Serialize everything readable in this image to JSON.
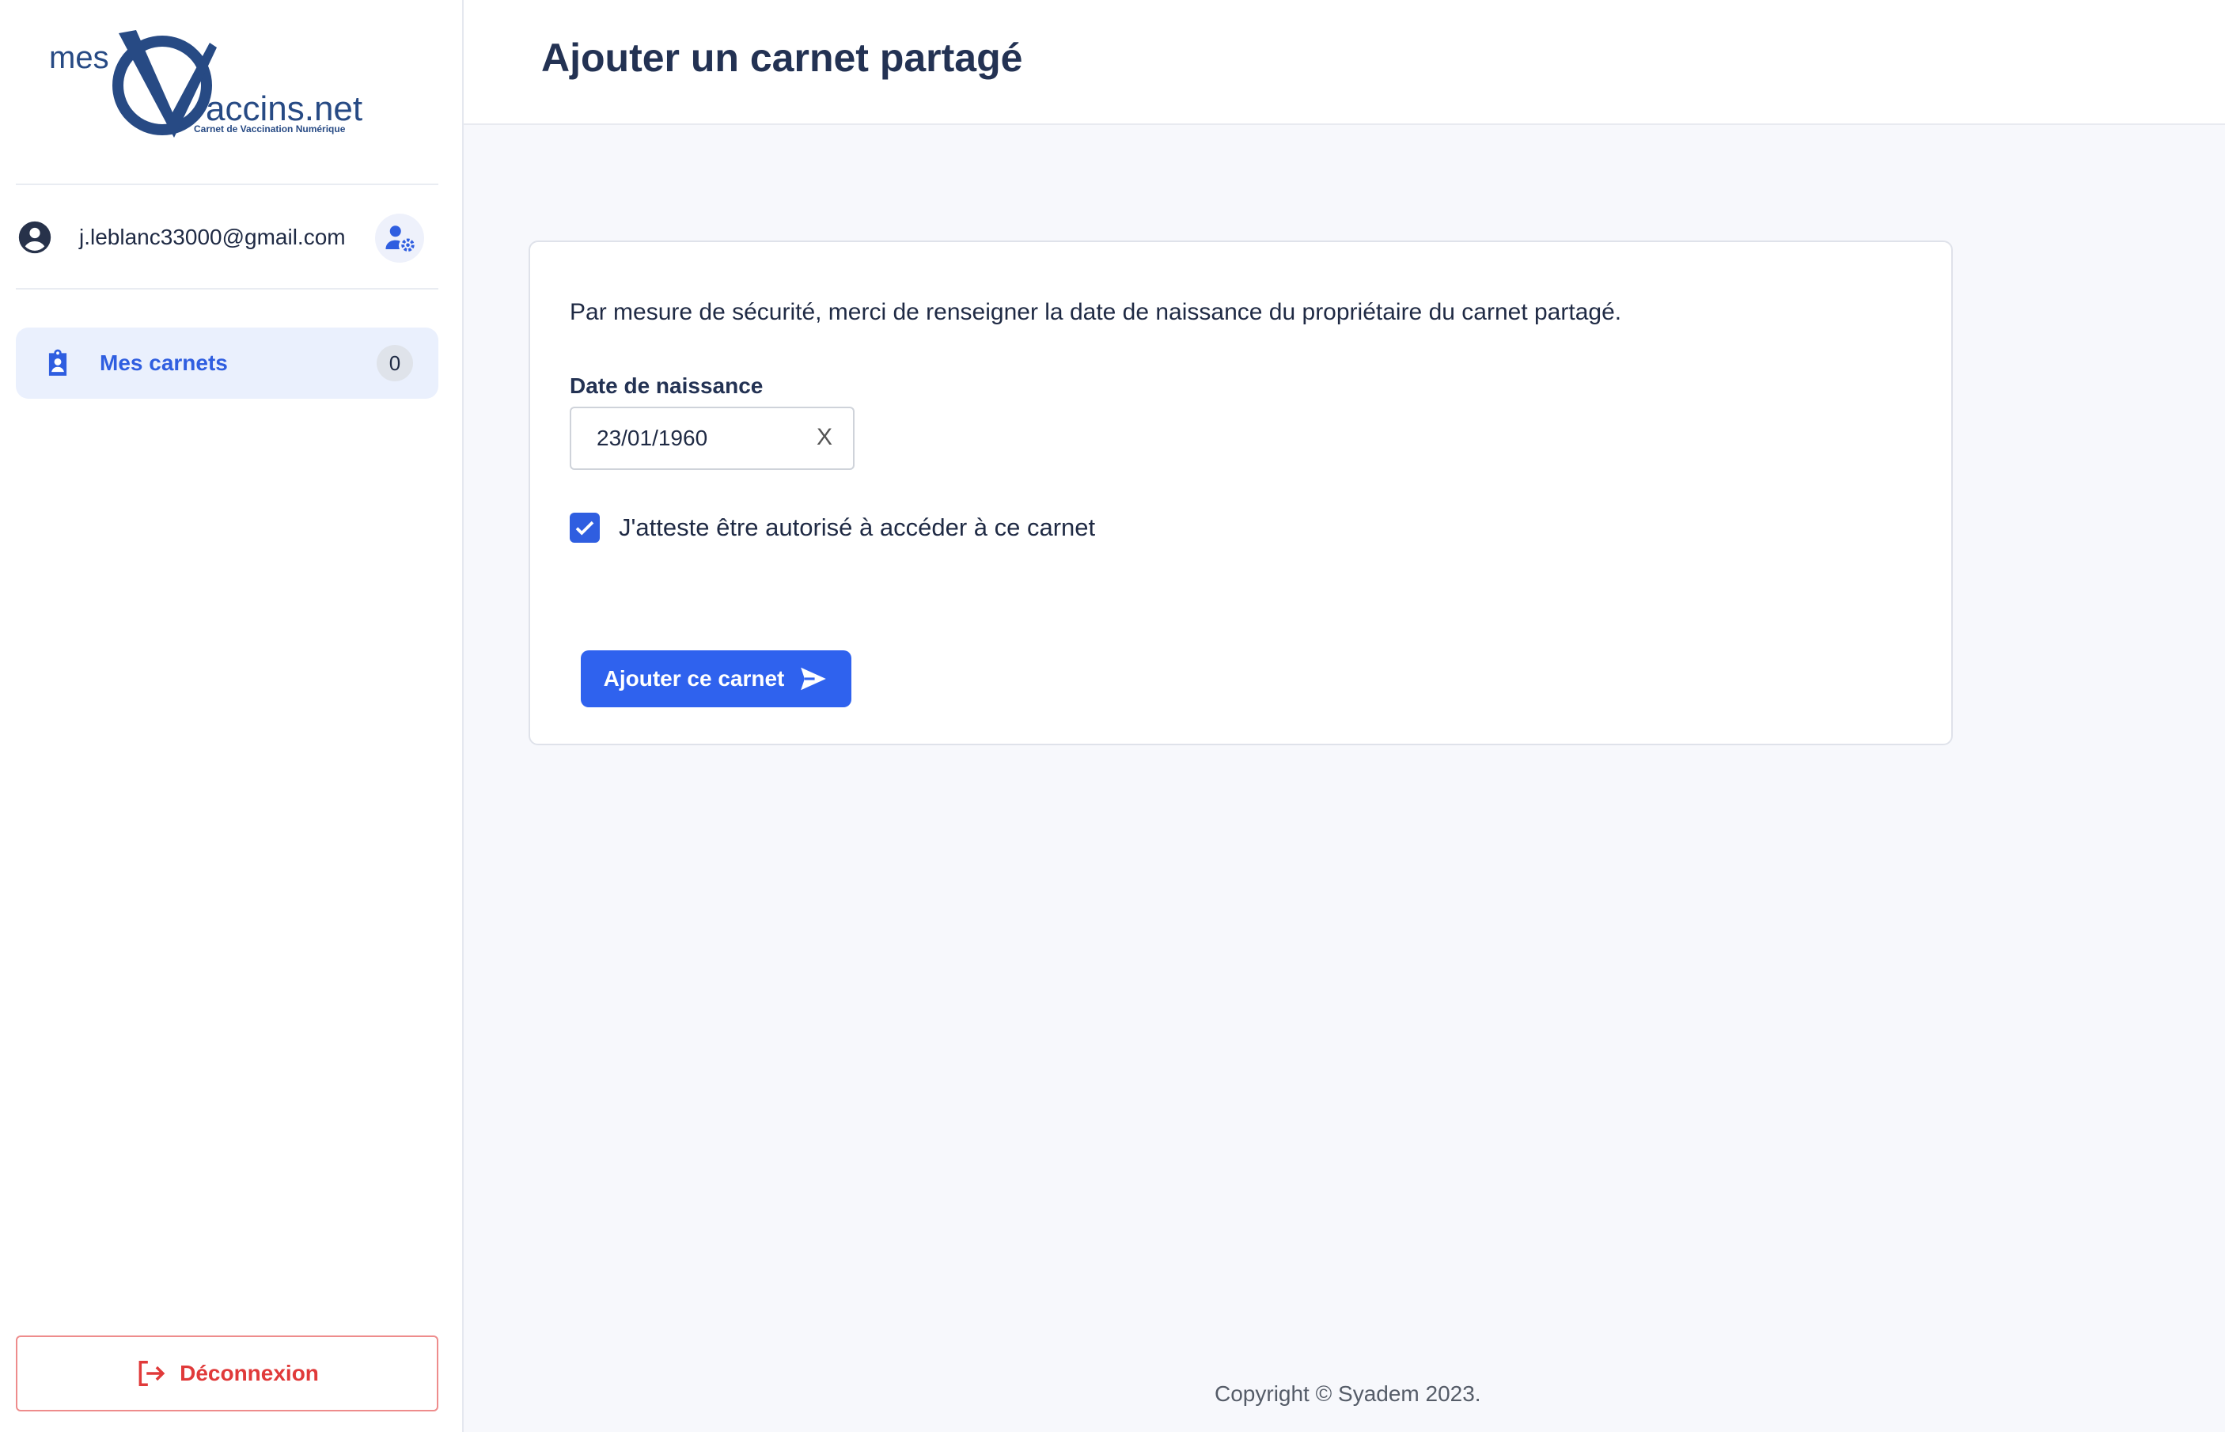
{
  "sidebar": {
    "logo": {
      "text_mes": "mes",
      "text_brand": "accins.net",
      "subtitle": "Carnet de Vaccination Numérique"
    },
    "user": {
      "email": "j.leblanc33000@gmail.com",
      "icon": "account-circle-icon",
      "settings_icon": "user-settings-icon"
    },
    "nav": [
      {
        "label": "Mes carnets",
        "badge": "0",
        "icon": "clipboard-account-icon"
      }
    ],
    "logout": {
      "label": "Déconnexion",
      "icon": "logout-icon"
    }
  },
  "header": {
    "title": "Ajouter un carnet partagé"
  },
  "form": {
    "intro": "Par mesure de sécurité, merci de renseigner la date de naissance du propriétaire du carnet partagé.",
    "birthdate_label": "Date de naissance",
    "birthdate_value": "23/01/1960",
    "clear_label": "X",
    "consent_label": "J'atteste être autorisé à accéder à ce carnet",
    "consent_checked": true,
    "submit_label": "Ajouter ce carnet",
    "submit_icon": "send-icon"
  },
  "footer": {
    "copyright": "Copyright © Syadem 2023."
  },
  "colors": {
    "primary": "#2f62ee",
    "danger": "#e03a3a",
    "logo": "#274a84"
  }
}
